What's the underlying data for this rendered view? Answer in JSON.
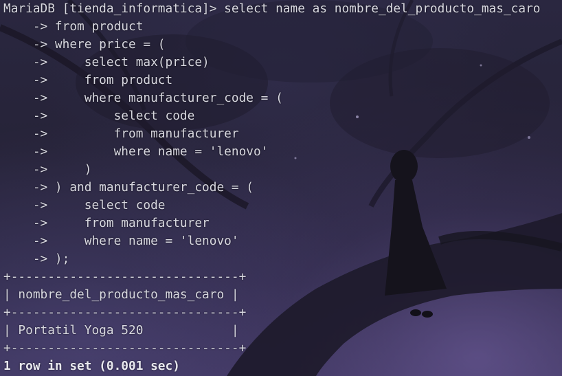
{
  "terminal": {
    "lines": [
      "MariaDB [tienda_informatica]> select name as nombre_del_producto_mas_caro",
      "    -> from product",
      "    -> where price = (",
      "    ->     select max(price)",
      "    ->     from product",
      "    ->     where manufacturer_code = (",
      "    ->         select code",
      "    ->         from manufacturer",
      "    ->         where name = 'lenovo'",
      "    ->     )",
      "    -> ) and manufacturer_code = (",
      "    ->     select code",
      "    ->     from manufacturer",
      "    ->     where name = 'lenovo'",
      "    -> );",
      "+-------------------------------+",
      "| nombre_del_producto_mas_caro |",
      "+-------------------------------+",
      "| Portatil Yoga 520            |",
      "+-------------------------------+",
      "1 row in set (0.001 sec)"
    ]
  }
}
